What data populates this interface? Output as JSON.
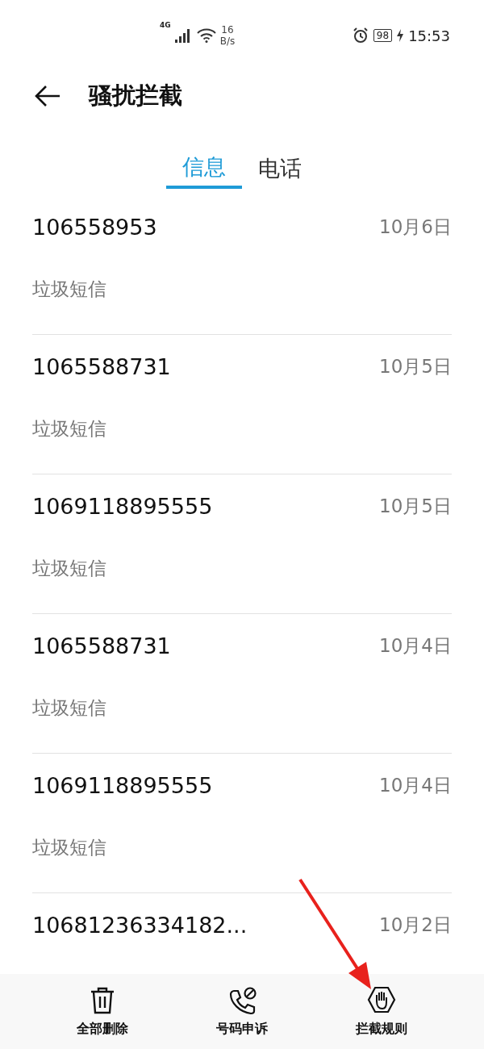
{
  "status_bar": {
    "network": "4G",
    "speed_value": "16",
    "speed_unit": "B/s",
    "battery": "98",
    "time": "15:53"
  },
  "header": {
    "title": "骚扰拦截"
  },
  "tabs": [
    {
      "label": "信息",
      "selected": true
    },
    {
      "label": "电话",
      "selected": false
    }
  ],
  "messages": [
    {
      "number": "106558953",
      "date": "10月6日",
      "preview": "垃圾短信"
    },
    {
      "number": "1065588731",
      "date": "10月5日",
      "preview": "垃圾短信"
    },
    {
      "number": "1069118895555",
      "date": "10月5日",
      "preview": "垃圾短信"
    },
    {
      "number": "1065588731",
      "date": "10月4日",
      "preview": "垃圾短信"
    },
    {
      "number": "1069118895555",
      "date": "10月4日",
      "preview": "垃圾短信"
    },
    {
      "number": "10681236334182...",
      "date": "10月2日"
    }
  ],
  "toolbar": [
    {
      "kind": "trash",
      "label": "全部删除"
    },
    {
      "kind": "phone-block",
      "label": "号码申诉"
    },
    {
      "kind": "hand",
      "label": "拦截规则"
    }
  ]
}
